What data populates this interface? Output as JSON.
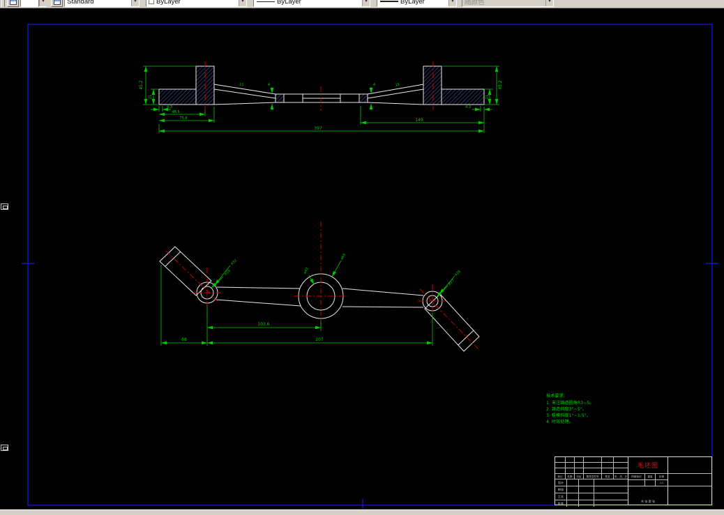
{
  "toolbar": {
    "style_value": "Standard",
    "color_value": "ByLayer",
    "linetype_value": "ByLayer",
    "lineweight_value": "ByLayer",
    "plotstyle_value": "随颜色"
  },
  "drawing": {
    "colors": {
      "frame": "#1616c8",
      "geometry": "#e8e8e8",
      "dimension": "#00c800",
      "centerline": "#d40000",
      "hatch": "#5a5ac8",
      "notes": "#00d200",
      "title_red": "#e01010"
    },
    "section_view": {
      "dims": {
        "height_left": "45.2",
        "thick_left": "21",
        "step_left": "4.3",
        "hub_left": "48.5",
        "flange_left": "75.8",
        "overall": "397",
        "right_span": "149",
        "height_right": "45.2",
        "thick_right": "21",
        "step_right": "4.3",
        "web_left": "15",
        "web_right": "15",
        "rib_left": "4",
        "rib_right": "4"
      }
    },
    "plan_view": {
      "dims": {
        "left_arm": "68",
        "center_offset": "103.6",
        "span": "207",
        "left_hole": "⌀18",
        "left_boss": "⌀32",
        "center_hole": "⌀42",
        "center_boss": "⌀64",
        "right_hole": "⌀17",
        "right_boss": "⌀28"
      }
    },
    "notes": {
      "title": "技术要求:",
      "line1": "1. 未注铸造圆角R3~5。",
      "line2": "2. 铸造斜度3°~5°。",
      "line3": "3. 拔模斜度1°~1.5°。",
      "line4": "4. 时效处理。"
    }
  },
  "title_block": {
    "drawing_title": "毛坯图",
    "rev_headers": [
      "标记",
      "处数",
      "分区",
      "更改文件号",
      "签名",
      "年、月、日"
    ],
    "sign_labels": [
      "设计",
      "审核",
      "工艺",
      "批准"
    ],
    "stage_label": "阶段标记",
    "weight_label": "重量",
    "scale_label": "比例",
    "scale_value": "1:1",
    "sheet_info": "共 张 第 张"
  }
}
